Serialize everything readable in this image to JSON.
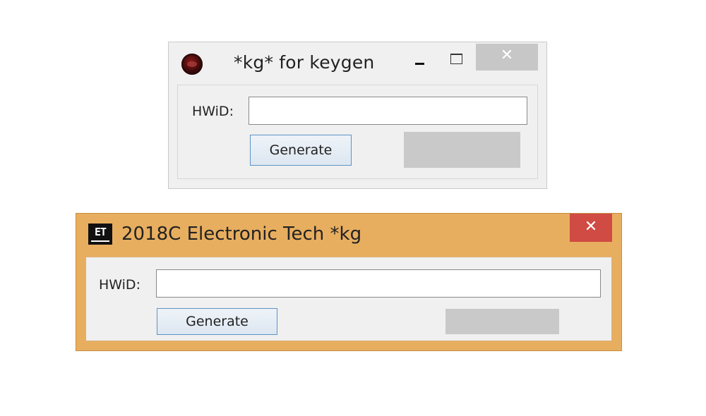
{
  "window1": {
    "title": "*kg* for keygen",
    "icon": "keygen-app-icon",
    "hwid_label": "HWiD:",
    "hwid_value": "",
    "generate_label": "Generate",
    "close_symbol": "✕",
    "accent_colors": {
      "frame": "#f0f0f0",
      "close": "#c7c7c7"
    }
  },
  "window2": {
    "title": "2018C Electronic Tech *kg",
    "icon_text": "ET",
    "hwid_label": "HWiD:",
    "hwid_value": "",
    "generate_label": "Generate",
    "close_symbol": "✕",
    "accent_colors": {
      "frame": "#e8ae5f",
      "close": "#cf4b44"
    }
  }
}
